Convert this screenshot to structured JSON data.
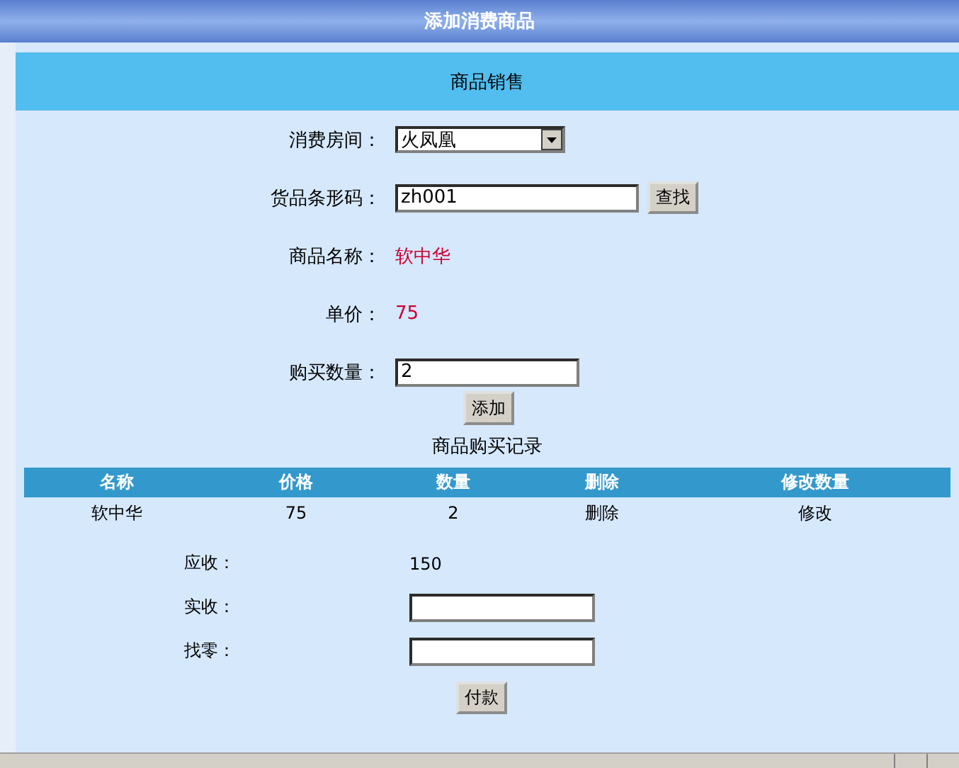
{
  "header": {
    "title": "添加消费商品"
  },
  "section": {
    "title": "商品销售"
  },
  "form": [
    {
      "kind": "select",
      "label": "消费房间：",
      "value": "火凤凰"
    },
    {
      "kind": "input",
      "label": "货品条形码：",
      "value": "zh001",
      "button": "查找"
    },
    {
      "kind": "text",
      "label": "商品名称：",
      "value": "软中华"
    },
    {
      "kind": "text",
      "label": "单价：",
      "value": "75"
    },
    {
      "kind": "input",
      "label": "购买数量：",
      "value": "2"
    }
  ],
  "add_button": "添加",
  "records": {
    "title": "商品购买记录",
    "columns": [
      "名称",
      "价格",
      "数量",
      "删除",
      "修改数量"
    ],
    "rows": [
      [
        "软中华",
        "75",
        "2",
        "删除",
        "修改"
      ]
    ]
  },
  "payment": [
    {
      "kind": "text",
      "label": "应收：",
      "value": "150"
    },
    {
      "kind": "input",
      "label": "实收："
    },
    {
      "kind": "input",
      "label": "找零："
    }
  ],
  "pay_button": "付款"
}
